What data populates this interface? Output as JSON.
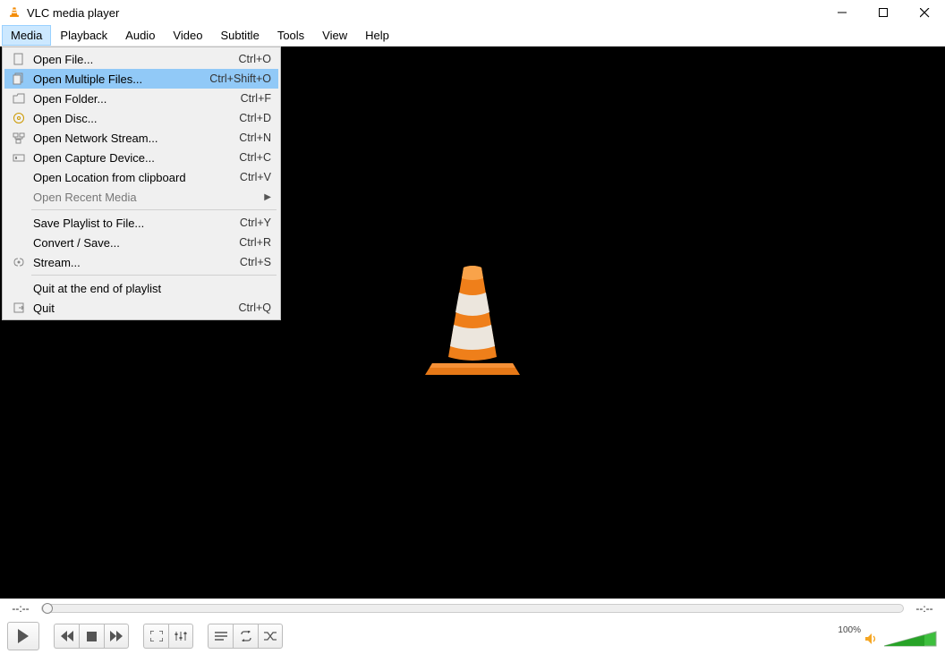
{
  "title": "VLC media player",
  "menubar": [
    "Media",
    "Playback",
    "Audio",
    "Video",
    "Subtitle",
    "Tools",
    "View",
    "Help"
  ],
  "active_menu_index": 0,
  "dropdown": {
    "highlight_index": 1,
    "items": [
      {
        "icon": "file",
        "label": "Open File...",
        "shortcut": "Ctrl+O"
      },
      {
        "icon": "files",
        "label": "Open Multiple Files...",
        "shortcut": "Ctrl+Shift+O"
      },
      {
        "icon": "folder",
        "label": "Open Folder...",
        "shortcut": "Ctrl+F"
      },
      {
        "icon": "disc",
        "label": "Open Disc...",
        "shortcut": "Ctrl+D"
      },
      {
        "icon": "network",
        "label": "Open Network Stream...",
        "shortcut": "Ctrl+N"
      },
      {
        "icon": "capture",
        "label": "Open Capture Device...",
        "shortcut": "Ctrl+C"
      },
      {
        "icon": "",
        "label": "Open Location from clipboard",
        "shortcut": "Ctrl+V"
      },
      {
        "icon": "",
        "label": "Open Recent Media",
        "shortcut": "",
        "submenu": true,
        "disabled": true
      },
      {
        "sep": true
      },
      {
        "icon": "",
        "label": "Save Playlist to File...",
        "shortcut": "Ctrl+Y"
      },
      {
        "icon": "",
        "label": "Convert / Save...",
        "shortcut": "Ctrl+R"
      },
      {
        "icon": "stream",
        "label": "Stream...",
        "shortcut": "Ctrl+S"
      },
      {
        "sep": true
      },
      {
        "icon": "",
        "label": "Quit at the end of playlist",
        "shortcut": ""
      },
      {
        "icon": "quit",
        "label": "Quit",
        "shortcut": "Ctrl+Q"
      }
    ]
  },
  "time": {
    "elapsed": "--:--",
    "remaining": "--:--"
  },
  "volume": {
    "label": "100%"
  }
}
